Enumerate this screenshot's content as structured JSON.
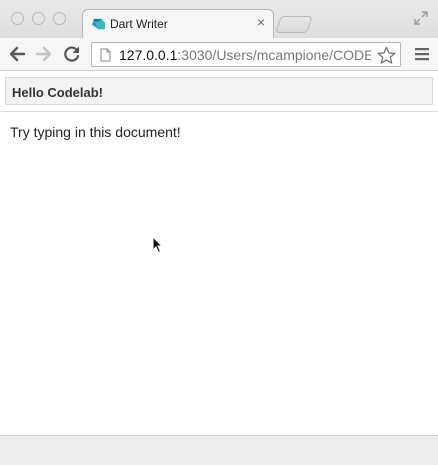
{
  "browser": {
    "tab": {
      "title": "Dart Writer",
      "close_label": "×"
    },
    "address_bar": {
      "host": "127.0.0.1",
      "rest": ":3030/Users/mcampione/CODE"
    }
  },
  "app": {
    "title": "Hello Codelab!",
    "editor_text": "Try typing in this document!"
  }
}
